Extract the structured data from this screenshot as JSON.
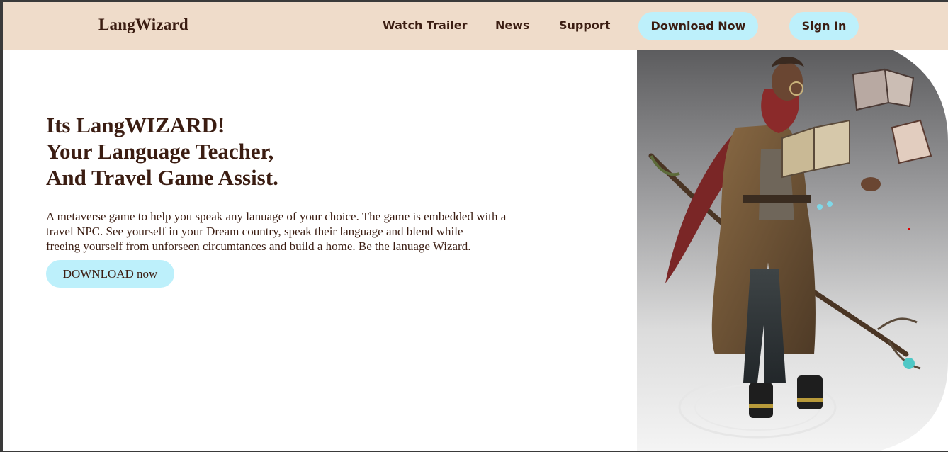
{
  "brand": {
    "name": "LangWizard"
  },
  "nav": {
    "links": [
      {
        "label": "Watch Trailer"
      },
      {
        "label": "News"
      },
      {
        "label": "Support"
      }
    ],
    "download_label": "Download Now",
    "signin_label": "Sign In"
  },
  "hero": {
    "title_lines": [
      "Its LangWIZARD!",
      "Your Language Teacher,",
      "And Travel Game Assist."
    ],
    "description_lines": [
      "A metaverse game to help you speak any lanuage of your choice. The game is embedded with a",
      "travel NPC. See yourself in your Dream country, speak their language and blend while",
      "freeing yourself from unforseen circumtances and build a home. Be the lanuage Wizard."
    ],
    "cta_label": "DOWNLOAD now",
    "image_subject": "wizard-character-illustration"
  },
  "colors": {
    "navbar_bg": "#efdcca",
    "text_brown": "#3b1d12",
    "button_cyan": "#bdf0fb",
    "page_bg": "#ffffff"
  }
}
